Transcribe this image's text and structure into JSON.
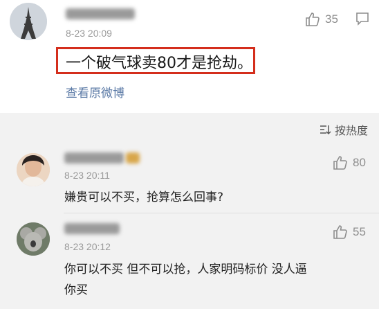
{
  "main_comment": {
    "time": "8-23 20:09",
    "text": "一个破气球卖80才是抢劫。",
    "likes": "35",
    "view_original": "查看原微博"
  },
  "sort": {
    "label": "按热度"
  },
  "replies": [
    {
      "time": "8-23 20:11",
      "text": "嫌贵可以不买，抢算怎么回事?",
      "likes": "80"
    },
    {
      "time": "8-23 20:12",
      "text_line1": "你可以不买 但不可以抢，人家明码标价 没人逼",
      "text_line2": "你买",
      "likes": "55"
    }
  ],
  "colors": {
    "highlight": "#d42e1c",
    "link": "#5b7aa6",
    "muted": "#9a9a9a"
  },
  "icons": [
    "thumbs-up-icon",
    "comment-icon",
    "sort-icon"
  ]
}
